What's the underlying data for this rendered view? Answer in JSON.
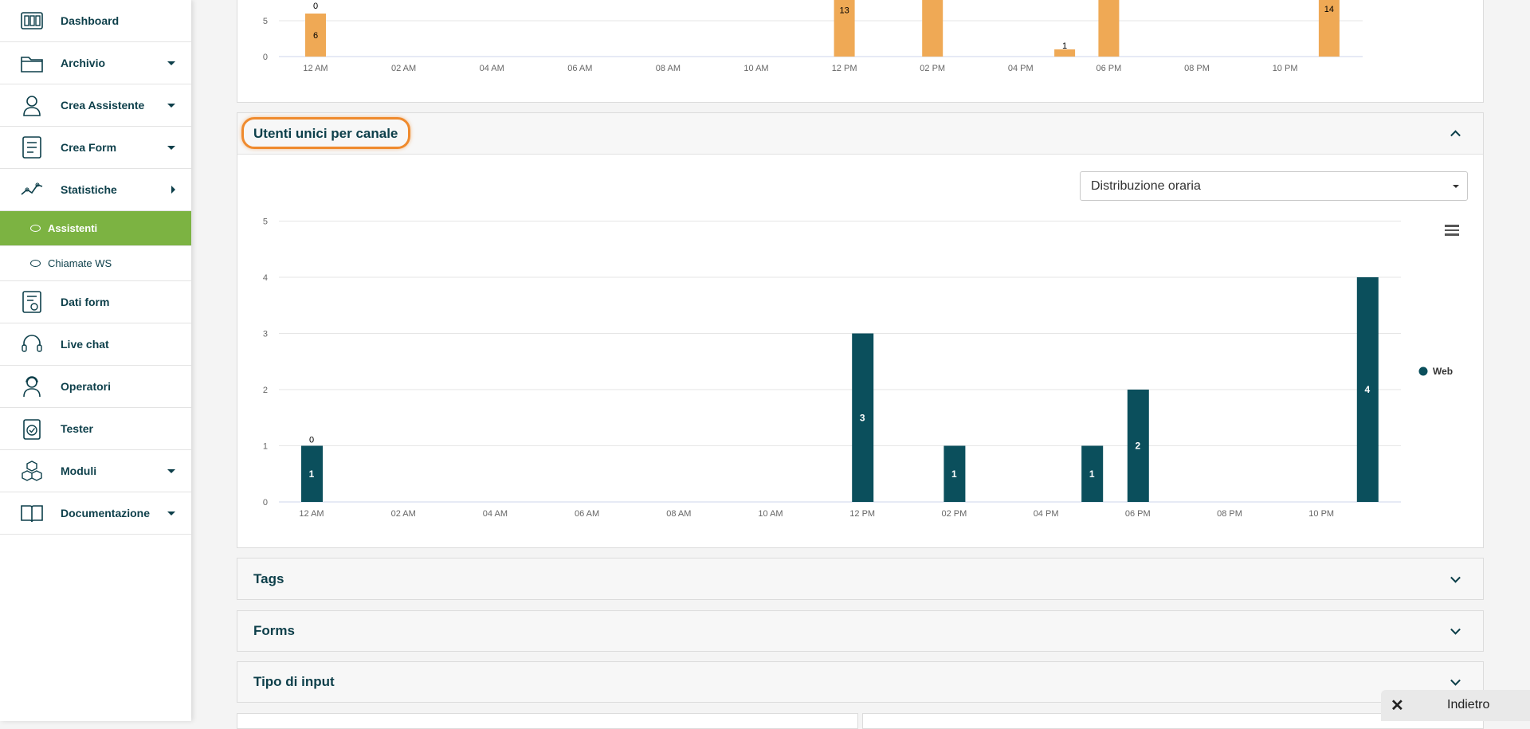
{
  "sidebar": {
    "items": [
      {
        "label": "Dashboard",
        "icon": "dashboard-icon",
        "caret": ""
      },
      {
        "label": "Archivio",
        "icon": "folder-icon",
        "caret": "down"
      },
      {
        "label": "Crea Assistente",
        "icon": "assistant-icon",
        "caret": "down"
      },
      {
        "label": "Crea Form",
        "icon": "form-icon",
        "caret": "down"
      },
      {
        "label": "Statistiche",
        "icon": "stats-icon",
        "caret": "right"
      }
    ],
    "sub_items": [
      {
        "label": "Assistenti",
        "active": true
      },
      {
        "label": "Chiamate WS",
        "active": false
      }
    ],
    "items_after": [
      {
        "label": "Dati form",
        "icon": "form-data-icon",
        "caret": ""
      },
      {
        "label": "Live chat",
        "icon": "headset-icon",
        "caret": ""
      },
      {
        "label": "Operatori",
        "icon": "operator-icon",
        "caret": ""
      },
      {
        "label": "Tester",
        "icon": "clipboard-check-icon",
        "caret": ""
      },
      {
        "label": "Moduli",
        "icon": "cubes-icon",
        "caret": "down"
      },
      {
        "label": "Documentazione",
        "icon": "book-icon",
        "caret": "down"
      }
    ]
  },
  "panels": {
    "utenti_title": "Utenti unici per canale",
    "select_value": "Distribuzione oraria",
    "tags_title": "Tags",
    "forms_title": "Forms",
    "tipo_input_title": "Tipo di input"
  },
  "back_button": {
    "label": "Indietro",
    "close": "✕"
  },
  "colors": {
    "accent_green": "#7cb342",
    "top_bar": "#efa955",
    "bottom_bar": "#0b4f5c",
    "highlight": "#ef8a2d"
  },
  "chart_data": [
    {
      "type": "bar",
      "partial": true,
      "x_tick_labels": [
        "12 AM",
        "02 AM",
        "04 AM",
        "06 AM",
        "08 AM",
        "10 AM",
        "12 PM",
        "02 PM",
        "04 PM",
        "06 PM",
        "08 PM",
        "10 PM"
      ],
      "y_tick_labels": [
        "0",
        "5"
      ],
      "bars": [
        {
          "hour": 0,
          "label": "6",
          "total_label": "0",
          "value": 6
        },
        {
          "hour": 12,
          "label": "13",
          "value": 13
        },
        {
          "hour": 14,
          "label": "",
          "value": 20
        },
        {
          "hour": 17,
          "label": "1",
          "value": 1
        },
        {
          "hour": 18,
          "label": "",
          "value": 20
        },
        {
          "hour": 23,
          "label": "14",
          "value": 14
        }
      ],
      "ylim": [
        0,
        20
      ],
      "color": "#efa955"
    },
    {
      "type": "bar",
      "title": "Utenti unici per canale",
      "x_tick_labels": [
        "12 AM",
        "02 AM",
        "04 AM",
        "06 AM",
        "08 AM",
        "10 AM",
        "12 PM",
        "02 PM",
        "04 PM",
        "06 PM",
        "08 PM",
        "10 PM"
      ],
      "y_tick_labels": [
        "0",
        "1",
        "2",
        "3",
        "4",
        "5"
      ],
      "ylim": [
        0,
        5
      ],
      "series": [
        {
          "name": "Web",
          "color": "#0b4f5c",
          "values": [
            {
              "hour": 0,
              "value": 1,
              "total_label": "0"
            },
            {
              "hour": 12,
              "value": 3
            },
            {
              "hour": 14,
              "value": 1
            },
            {
              "hour": 17,
              "value": 1
            },
            {
              "hour": 18,
              "value": 2
            },
            {
              "hour": 23,
              "value": 4
            }
          ]
        }
      ],
      "legend": "right"
    }
  ]
}
